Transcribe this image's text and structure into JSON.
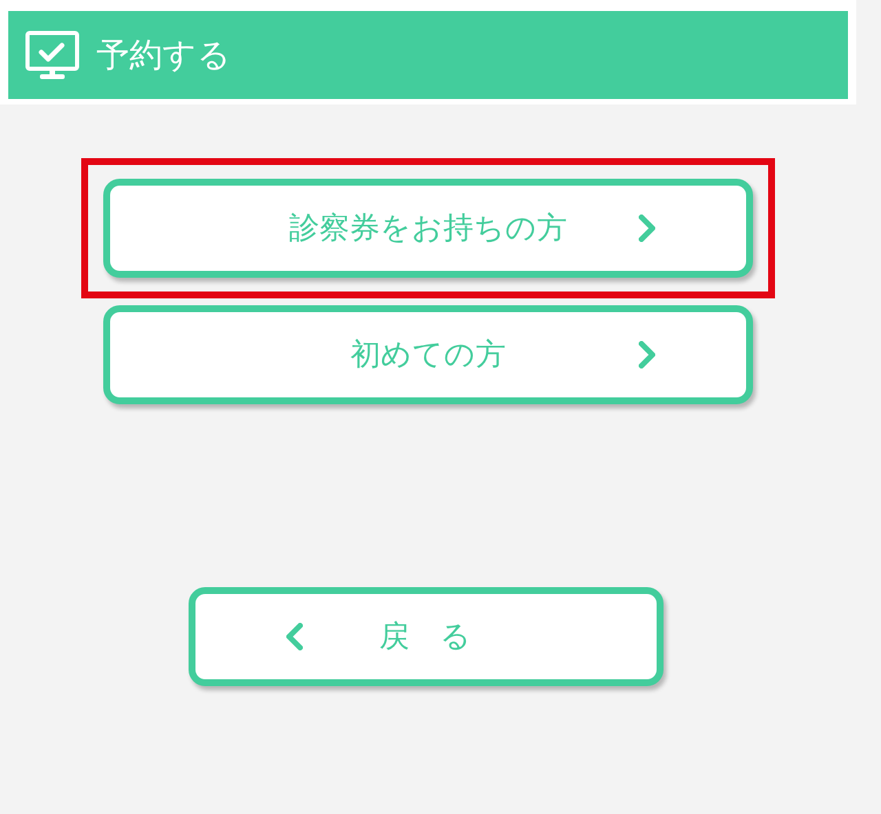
{
  "header": {
    "title": "予約する"
  },
  "options": [
    {
      "label": "診察券をお持ちの方",
      "highlighted": true
    },
    {
      "label": "初めての方",
      "highlighted": false
    }
  ],
  "back_button": {
    "label": "戻　る"
  }
}
